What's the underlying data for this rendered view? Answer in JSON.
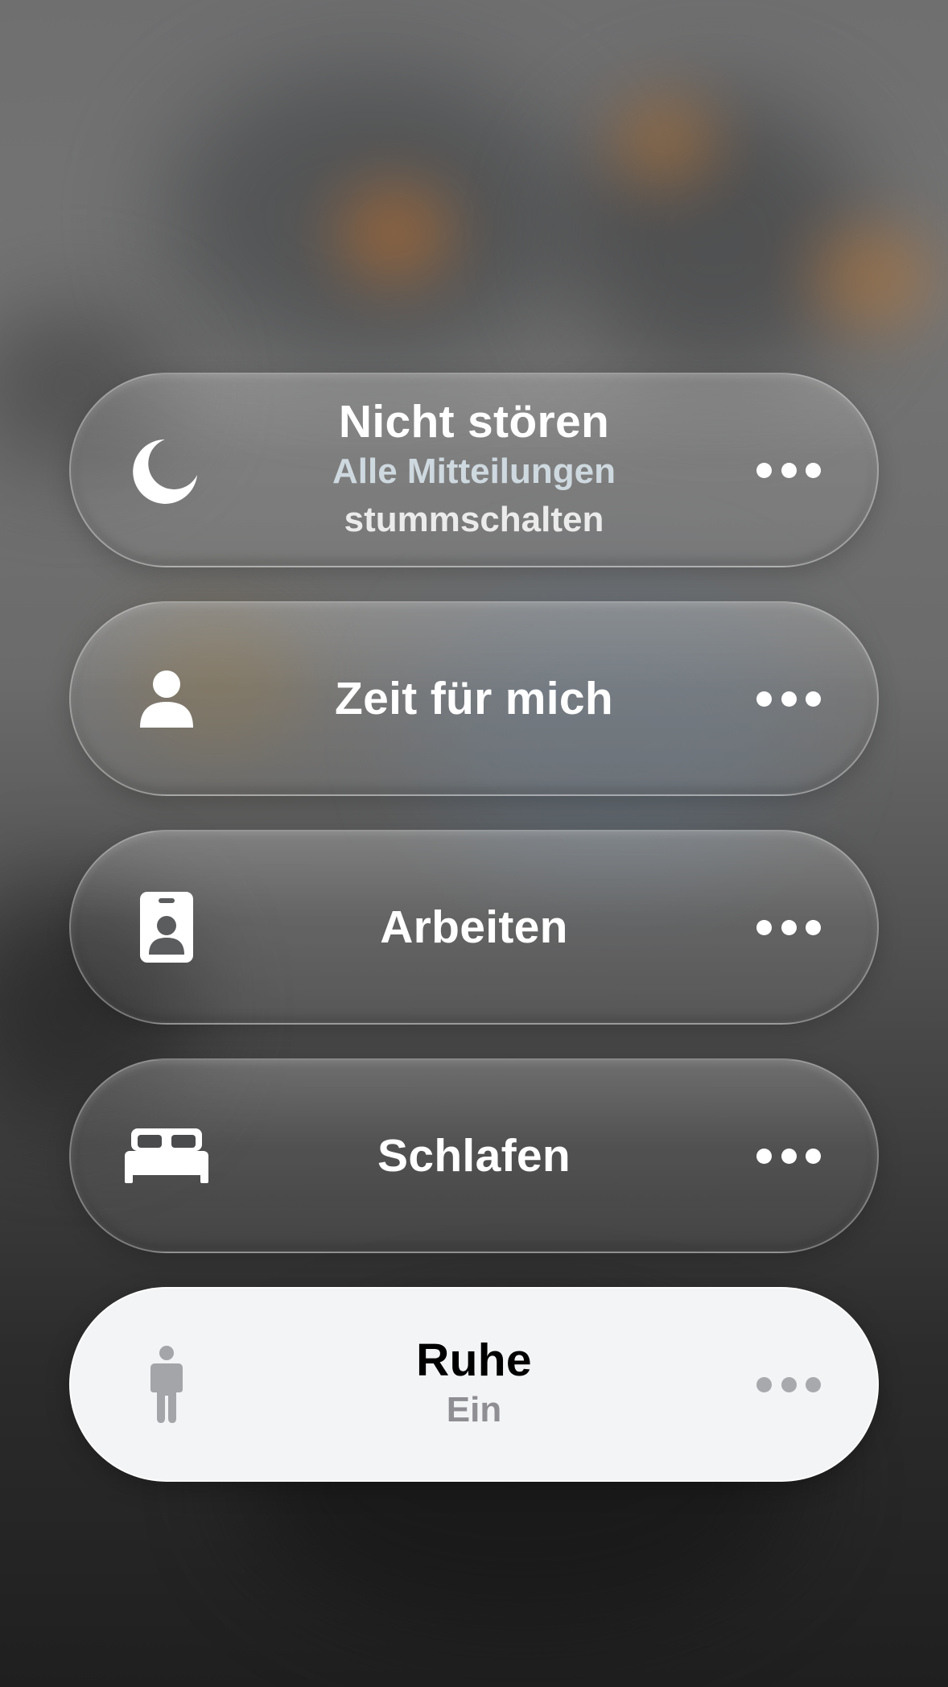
{
  "focus_modes": [
    {
      "title": "Nicht stören",
      "subtitle": "Alle Mitteilungen",
      "subtitle_line2": "stummschalten",
      "icon": "moon-icon",
      "active": false
    },
    {
      "title": "Zeit für mich",
      "icon": "person-icon",
      "active": false
    },
    {
      "title": "Arbeiten",
      "icon": "id-badge-icon",
      "active": false
    },
    {
      "title": "Schlafen",
      "icon": "bed-icon",
      "active": false
    },
    {
      "title": "Ruhe",
      "subtitle": "Ein",
      "icon": "standing-person-icon",
      "active": true
    }
  ],
  "colors": {
    "pill_active_bg": "#f2f4f5",
    "pill_text": "#ffffff",
    "active_title": "#000000",
    "active_subtitle": "#8e8e93"
  }
}
